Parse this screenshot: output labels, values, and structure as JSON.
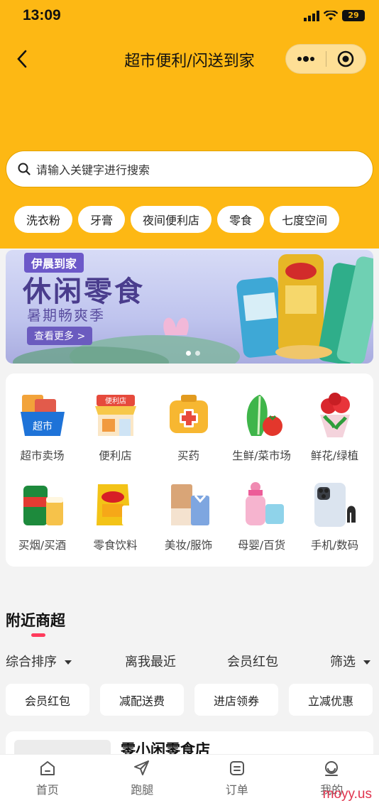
{
  "status": {
    "time": "13:09",
    "battery": "29"
  },
  "nav": {
    "title": "超市便利/闪送到家"
  },
  "search": {
    "placeholder": "请输入关键字进行搜索"
  },
  "chips": [
    "洗衣粉",
    "牙膏",
    "夜间便利店",
    "零食",
    "七度空间"
  ],
  "banner": {
    "brand": "伊晨到家",
    "title": "休闲零食",
    "subtitle": "暑期畅爽季",
    "cta": "查看更多 >"
  },
  "categories": [
    {
      "label": "超市卖场",
      "icon": "supermarket-basket-icon"
    },
    {
      "label": "便利店",
      "icon": "convenience-store-icon"
    },
    {
      "label": "买药",
      "icon": "medicine-box-icon"
    },
    {
      "label": "生鲜/菜市场",
      "icon": "vegetables-icon"
    },
    {
      "label": "鲜花/绿植",
      "icon": "flower-bouquet-icon"
    },
    {
      "label": "买烟/买酒",
      "icon": "beer-can-icon"
    },
    {
      "label": "零食饮料",
      "icon": "chips-bag-icon"
    },
    {
      "label": "美妆/服饰",
      "icon": "cosmetics-icon"
    },
    {
      "label": "母婴/百货",
      "icon": "baby-bottle-icon"
    },
    {
      "label": "手机/数码",
      "icon": "phone-icon"
    }
  ],
  "nearby": {
    "title": "附近商超",
    "sort": [
      "综合排序",
      "离我最近",
      "会员红包",
      "筛选"
    ],
    "filters": [
      "会员红包",
      "减配送费",
      "进店领券",
      "立减优惠"
    ],
    "store_name": "零小闲零食店"
  },
  "tabbar": [
    "首页",
    "跑腿",
    "订单",
    "我的"
  ],
  "watermark": "moyy.us",
  "colors": {
    "header": "#fdb814",
    "accent": "#ff3b5c"
  }
}
